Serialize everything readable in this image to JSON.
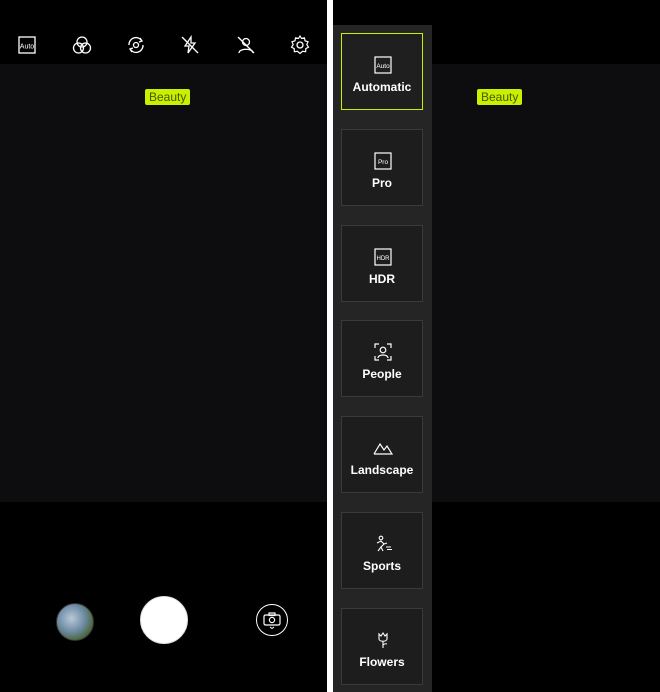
{
  "left_screen": {
    "top_icons": [
      "auto-mode-icon",
      "filter-icon",
      "flip-camera-icon",
      "flash-off-icon",
      "timer-off-icon",
      "settings-icon"
    ],
    "auto_text": "Auto",
    "beauty_label": "Beauty",
    "gallery_thumbnail": "gallery-thumbnail",
    "shutter": "shutter-button",
    "switch_camera": "switch-camera-icon"
  },
  "right_screen": {
    "beauty_label": "Beauty",
    "modes": [
      {
        "label": "Automatic",
        "icon_text": "Auto",
        "icon": "auto-mode-icon",
        "selected": true
      },
      {
        "label": "Pro",
        "icon_text": "Pro",
        "icon": "pro-mode-icon",
        "selected": false
      },
      {
        "label": "HDR",
        "icon_text": "HDR",
        "icon": "hdr-icon",
        "selected": false
      },
      {
        "label": "People",
        "icon": "people-icon",
        "selected": false
      },
      {
        "label": "Landscape",
        "icon": "landscape-icon",
        "selected": false
      },
      {
        "label": "Sports",
        "icon": "sports-icon",
        "selected": false
      },
      {
        "label": "Flowers",
        "icon": "flower-icon",
        "selected": false
      }
    ]
  },
  "colors": {
    "accent": "#c8f000",
    "background": "#000000",
    "panel": "#252525"
  }
}
